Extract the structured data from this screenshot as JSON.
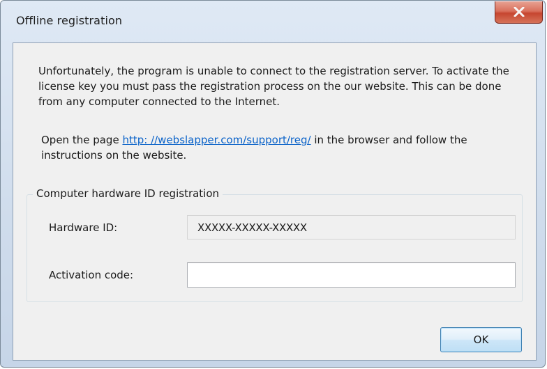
{
  "window": {
    "title": "Offline registration",
    "close_icon": "close-x-icon"
  },
  "intro": {
    "text": "Unfortunately, the program is unable to connect to the registration server. To activate the license key you must pass the registration process on the our website. This can be done from any computer connected to the Internet."
  },
  "instructions": {
    "prefix": "Open the page ",
    "link_text": "http: //webslapper.com/support/reg/",
    "suffix": " in the browser and follow the instructions on the website."
  },
  "group": {
    "legend": "Computer hardware ID registration",
    "hardware_id_label": "Hardware ID:",
    "hardware_id_value": "XXXXX-XXXXX-XXXXX",
    "activation_label": "Activation code:",
    "activation_value": ""
  },
  "buttons": {
    "ok_label": "OK"
  },
  "colors": {
    "link": "#0b63c9",
    "close_button": "#c64630",
    "dialog_frame": "#cfdcec"
  }
}
